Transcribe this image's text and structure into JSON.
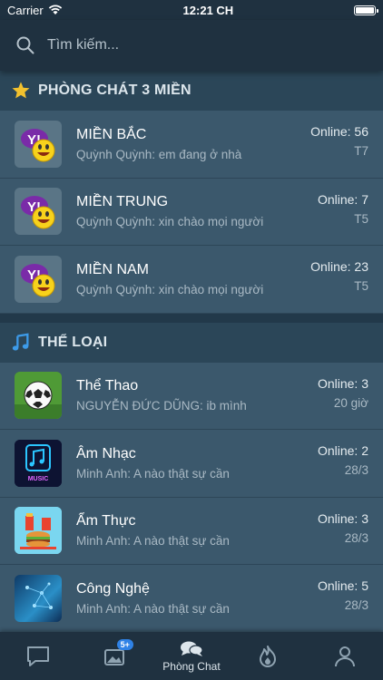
{
  "status_bar": {
    "carrier": "Carrier",
    "time": "12:21 CH"
  },
  "search": {
    "placeholder": "Tìm kiếm..."
  },
  "sections": {
    "regions": {
      "title": "PHÒNG CHÁT 3 MIỀN",
      "icon": "star-icon",
      "rooms": [
        {
          "name": "MIỀN BẮC",
          "last_message": "Quỳnh Quỳnh: em đang ở nhà",
          "online": "Online: 56",
          "time": "T7",
          "icon": "yahoo-messenger-icon"
        },
        {
          "name": "MIỀN TRUNG",
          "last_message": "Quỳnh Quỳnh:  xin chào mọi người",
          "online": "Online: 7",
          "time": "T5",
          "icon": "yahoo-messenger-icon"
        },
        {
          "name": "MIỀN NAM",
          "last_message": "Quỳnh Quỳnh:  xin chào mọi người",
          "online": "Online: 23",
          "time": "T5",
          "icon": "yahoo-messenger-icon"
        }
      ]
    },
    "categories": {
      "title": "THỂ LOẠI",
      "icon": "music-note-icon",
      "rooms": [
        {
          "name": "Thể Thao",
          "last_message": "NGUYỄN ĐỨC DŨNG: ib mình",
          "online": "Online: 3",
          "time": "20 giờ",
          "icon": "soccer-ball-icon"
        },
        {
          "name": "Âm Nhạc",
          "last_message": "Minh Anh: A nào thật sự cần",
          "online": "Online: 2",
          "time": "28/3",
          "icon": "music-icon",
          "icon_text": "MUSIC"
        },
        {
          "name": "Ẩm Thực",
          "last_message": "Minh Anh: A nào thật sự cần",
          "online": "Online: 3",
          "time": "28/3",
          "icon": "food-icon"
        },
        {
          "name": "Công Nghệ",
          "last_message": "Minh Anh: A nào thật sự cần",
          "online": "Online: 5",
          "time": "28/3",
          "icon": "technology-icon"
        }
      ]
    }
  },
  "tab_bar": {
    "tabs": [
      {
        "icon": "chat-bubble-icon",
        "label": ""
      },
      {
        "icon": "photos-icon",
        "label": "",
        "badge": "5+"
      },
      {
        "icon": "chat-room-icon",
        "label": "Phòng Chat",
        "active": true
      },
      {
        "icon": "flame-icon",
        "label": ""
      },
      {
        "icon": "profile-icon",
        "label": ""
      }
    ]
  },
  "colors": {
    "background": "#2e4a5e",
    "bar": "#1f3140",
    "row": "#3b586c",
    "accent": "#2f82e6",
    "star": "#f2c12e"
  }
}
